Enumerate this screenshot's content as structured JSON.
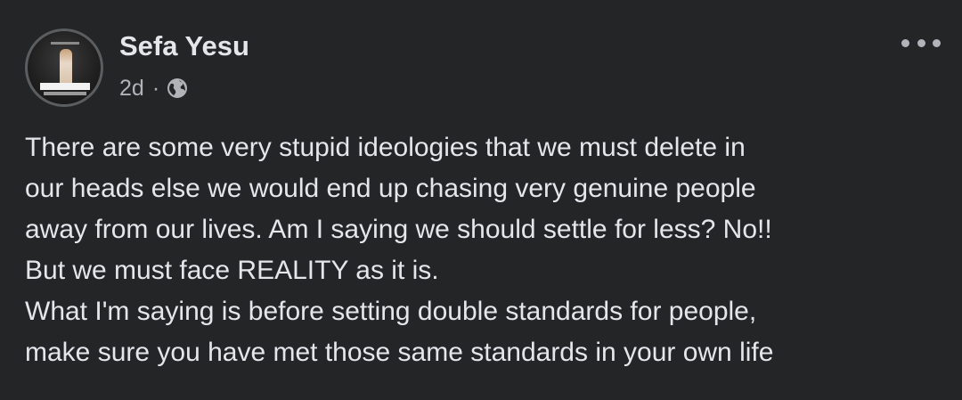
{
  "post": {
    "author": "Sefa Yesu",
    "time": "2d",
    "separator": "·",
    "privacy_icon": "globe-icon",
    "more_icon": "more-options-icon",
    "text": "There are some very stupid ideologies that we must delete in\nour heads else we would end up chasing very genuine people\naway from our lives. Am I saying we should settle for less? No!!\nBut we must face REALITY as it is.\nWhat I'm saying is before setting double standards for people,\nmake sure you have met those same standards in your own life"
  },
  "colors": {
    "background": "#242526",
    "primary_text": "#e4e6eb",
    "secondary_text": "#b0b3b8"
  }
}
